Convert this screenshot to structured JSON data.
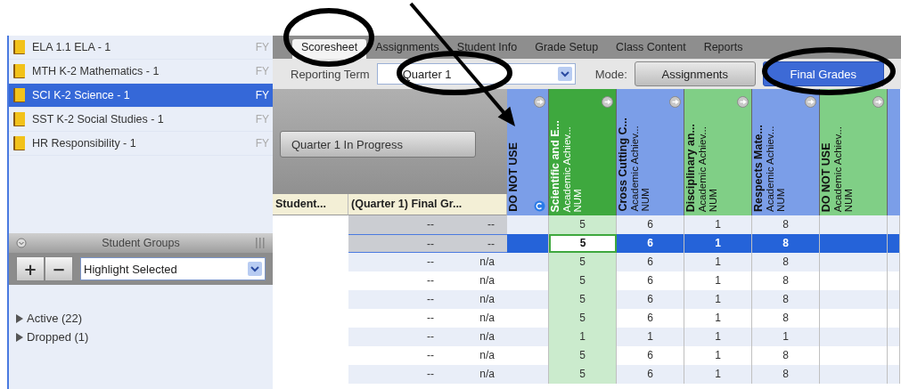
{
  "courses": [
    {
      "name": "ELA 1.1 ELA - 1",
      "term": "FY",
      "selected": false
    },
    {
      "name": "MTH K-2 Mathematics - 1",
      "term": "FY",
      "selected": false
    },
    {
      "name": "SCI K-2 Science - 1",
      "term": "FY",
      "selected": true
    },
    {
      "name": "SST K-2 Social Studies - 1",
      "term": "FY",
      "selected": false
    },
    {
      "name": "HR Responsibility - 1",
      "term": "FY",
      "selected": false
    }
  ],
  "student_groups": {
    "title": "Student Groups",
    "add": "+",
    "remove": "−",
    "filter": "Highlight Selected",
    "groups": [
      {
        "label": "Active (22)",
        "expanded": false
      },
      {
        "label": "Dropped (1)",
        "expanded": false
      }
    ]
  },
  "tabs": [
    {
      "label": "Scoresheet",
      "selected": true
    },
    {
      "label": "Assignments",
      "selected": false
    },
    {
      "label": "Student Info",
      "selected": false
    },
    {
      "label": "Grade Setup",
      "selected": false
    },
    {
      "label": "Class Content",
      "selected": false
    },
    {
      "label": "Reports",
      "selected": false
    }
  ],
  "toolbar": {
    "term_label": "Reporting Term",
    "term": "Quarter 1",
    "mode_label": "Mode:",
    "modes": [
      {
        "label": "Assignments",
        "selected": false
      },
      {
        "label": "Final Grades",
        "selected": true
      }
    ]
  },
  "grid": {
    "status_button": "Quarter 1 In Progress",
    "student_header": "Student...",
    "final_header": "(Quarter 1) Final Gr...",
    "columns": [
      {
        "kind": "unused",
        "title": "DO NOT USE",
        "color": "#7b9ee8",
        "selected": false,
        "flagged": true
      },
      {
        "kind": "score",
        "title": "Scientific and E...",
        "subtitle": "Academic Achiev...",
        "type": "NUM",
        "color": "#3ea83e",
        "selected": true,
        "flagged": false
      },
      {
        "kind": "score",
        "title": "Cross Cutting C...",
        "subtitle": "Academic Achiev...",
        "type": "NUM",
        "color": "#7b9ee8",
        "selected": false,
        "flagged": false
      },
      {
        "kind": "score",
        "title": "Disciplinary an...",
        "subtitle": "Academic Achiev...",
        "type": "NUM",
        "color": "#80cf86",
        "selected": false,
        "flagged": false
      },
      {
        "kind": "score",
        "title": "Respects Mate...",
        "subtitle": "Academic Achiev...",
        "type": "NUM",
        "color": "#7b9ee8",
        "selected": false,
        "flagged": false
      },
      {
        "kind": "unused",
        "title": "DO NOT USE",
        "subtitle": "Academic Achiev...",
        "type": "NUM",
        "color": "#80cf86",
        "selected": false,
        "flagged": false
      }
    ],
    "rows": [
      {
        "values": [
          "--",
          "--"
        ],
        "highlighted": true,
        "selected": false,
        "scores": [
          "5",
          "6",
          "1",
          "8"
        ]
      },
      {
        "values": [
          "--",
          "--"
        ],
        "highlighted": true,
        "selected": true,
        "scores": [
          "5",
          "6",
          "1",
          "8"
        ]
      },
      {
        "values": [
          "--",
          "n/a"
        ],
        "highlighted": false,
        "selected": false,
        "scores": [
          "5",
          "6",
          "1",
          "8"
        ]
      },
      {
        "values": [
          "--",
          "n/a"
        ],
        "highlighted": false,
        "selected": false,
        "scores": [
          "5",
          "6",
          "1",
          "8"
        ]
      },
      {
        "values": [
          "--",
          "n/a"
        ],
        "highlighted": false,
        "selected": false,
        "scores": [
          "5",
          "6",
          "1",
          "8"
        ]
      },
      {
        "values": [
          "--",
          "n/a"
        ],
        "highlighted": false,
        "selected": false,
        "scores": [
          "5",
          "6",
          "1",
          "8"
        ]
      },
      {
        "values": [
          "--",
          "n/a"
        ],
        "highlighted": false,
        "selected": false,
        "scores": [
          "1",
          "1",
          "1",
          "1"
        ]
      },
      {
        "values": [
          "--",
          "n/a"
        ],
        "highlighted": false,
        "selected": false,
        "scores": [
          "5",
          "6",
          "1",
          "8"
        ]
      },
      {
        "values": [
          "--",
          "n/a"
        ],
        "highlighted": false,
        "selected": false,
        "scores": [
          "5",
          "6",
          "1",
          "8"
        ]
      }
    ]
  }
}
